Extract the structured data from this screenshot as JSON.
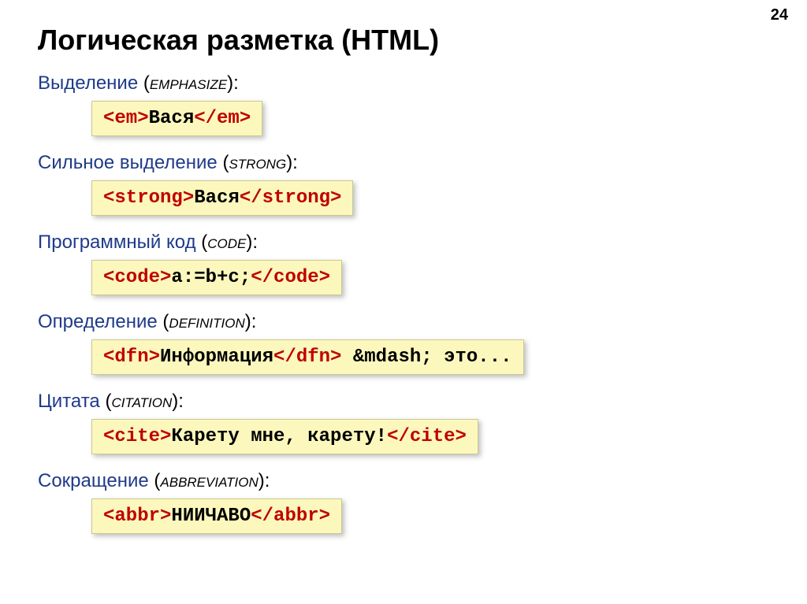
{
  "page_number": "24",
  "title": "Логическая разметка (HTML)",
  "sections": [
    {
      "native": "Выделение",
      "eng": "emphasize",
      "open": "<em>",
      "text": "Вася",
      "close": "</em>",
      "after": ""
    },
    {
      "native": "Сильное выделение",
      "eng": "strong",
      "open": "<strong>",
      "text": "Вася",
      "close": "</strong>",
      "after": ""
    },
    {
      "native": "Программный код",
      "eng": "code",
      "open": "<code>",
      "text": "a:=b+c;",
      "close": "</code>",
      "after": ""
    },
    {
      "native": "Определение",
      "eng": "definition",
      "open": "<dfn>",
      "text": "Информация",
      "close": "</dfn>",
      "after": " &mdash; это..."
    },
    {
      "native": "Цитата",
      "eng": "citation",
      "open": "<cite>",
      "text": "Карету мне, карету!",
      "close": "</cite>",
      "after": ""
    },
    {
      "native": "Сокращение",
      "eng": "abbreviation",
      "open": "<abbr>",
      "text": "НИИЧАВО",
      "close": "</abbr>",
      "after": ""
    }
  ]
}
